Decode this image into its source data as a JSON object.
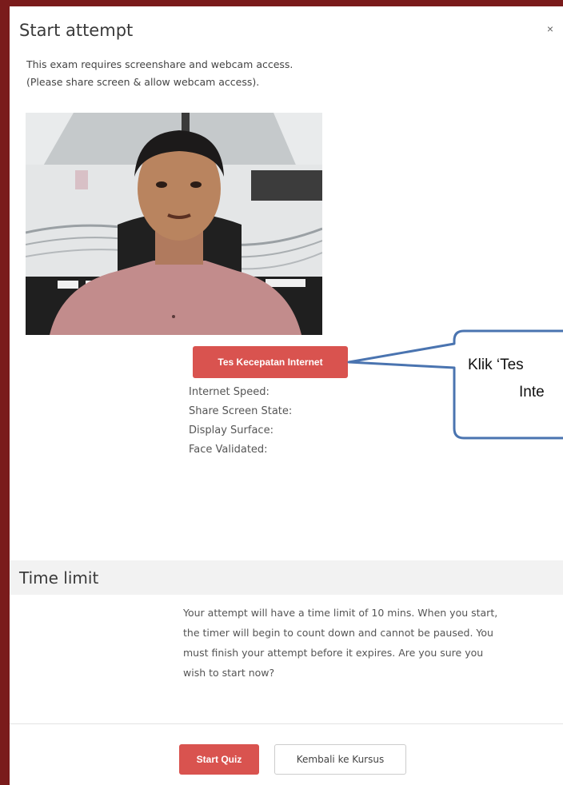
{
  "modal": {
    "title": "Start attempt",
    "close_glyph": "×",
    "intro_line1": "This exam requires screenshare and webcam access.",
    "intro_line2": "(Please share screen & allow webcam access).",
    "speed_test_button": "Tes Kecepatan Internet",
    "status": {
      "internet_speed": "Internet Speed:",
      "share_screen_state": "Share Screen State:",
      "display_surface": "Display Surface:",
      "face_validated": "Face Validated:"
    },
    "time_limit": {
      "heading": "Time limit",
      "line1": "Your attempt will have a time limit of 10 mins. When you start,",
      "line2": "the timer will begin to count down and cannot be paused. You",
      "line3": "must finish your attempt before it expires. Are you sure you",
      "line4": "wish to start now?"
    },
    "footer": {
      "start_button": "Start Quiz",
      "back_button": "Kembali ke Kursus"
    }
  },
  "callout": {
    "line1": "Klik ‘Tes",
    "line2": "Inte"
  },
  "colors": {
    "primary_button": "#d9534f",
    "backdrop": "#7a1b1b",
    "callout_border": "#4a74b0"
  },
  "icons": {
    "close": "close-icon",
    "webcam": "webcam-preview"
  }
}
